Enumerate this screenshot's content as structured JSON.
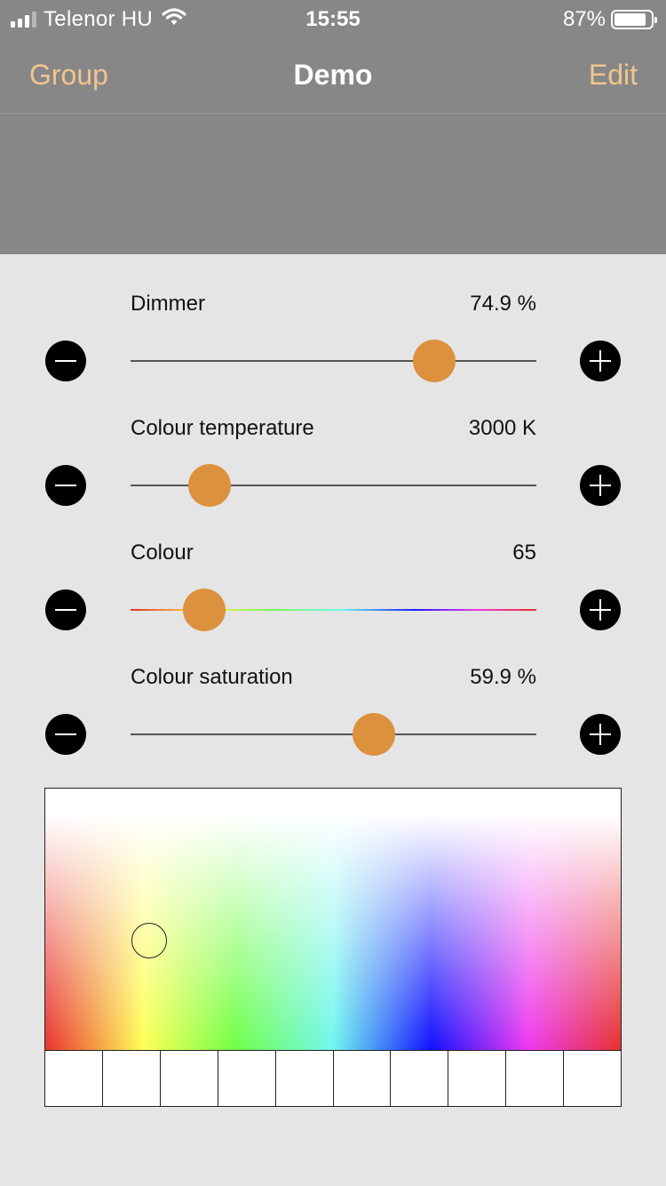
{
  "status_bar": {
    "carrier": "Telenor HU",
    "time": "15:55",
    "battery_percent_text": "87%",
    "battery_level": 0.87
  },
  "nav": {
    "left": "Group",
    "title": "Demo",
    "right": "Edit"
  },
  "controls": [
    {
      "label": "Dimmer",
      "value": "74.9 %",
      "level": 0.749
    },
    {
      "label": "Colour temperature",
      "value": "3000 K",
      "level": 0.195
    },
    {
      "label": "Colour",
      "value": "65",
      "level": 0.182
    },
    {
      "label": "Colour saturation",
      "value": "59.9 %",
      "level": 0.599
    }
  ],
  "colour_picker": {
    "selected_hue_fraction": 0.18,
    "selected_brightness_fraction": 0.58,
    "preset_count": 10
  },
  "colors": {
    "accent_thumb": "#dc913f",
    "nav_button": "#f2c58f",
    "header_bg": "#878787",
    "page_bg": "#e5e5e5"
  }
}
